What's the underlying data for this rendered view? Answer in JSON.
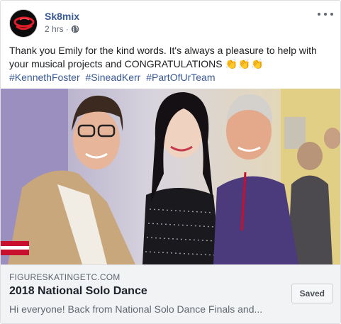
{
  "post": {
    "author": "Sk8mix",
    "timestamp": "2 hrs",
    "separator": "·",
    "message": "Thank you Emily for the kind words. It's always a pleasure to help with your musical projects and CONGRATULATIONS",
    "claps": "👏👏👏",
    "hashtags": [
      "#KennethFoster",
      "#SineadKerr",
      "#PartOfUrTeam"
    ]
  },
  "link_preview": {
    "domain": "FIGURESKATINGETC.COM",
    "title": "2018 National Solo Dance",
    "description": "Hi everyone! Back from National Solo Dance Finals and...",
    "saved_label": "Saved"
  },
  "icons": {
    "menu": "more-options-icon",
    "privacy": "globe-icon"
  },
  "colors": {
    "link": "#385898",
    "secondary_text": "#606770",
    "preview_bg": "#f2f3f5"
  }
}
